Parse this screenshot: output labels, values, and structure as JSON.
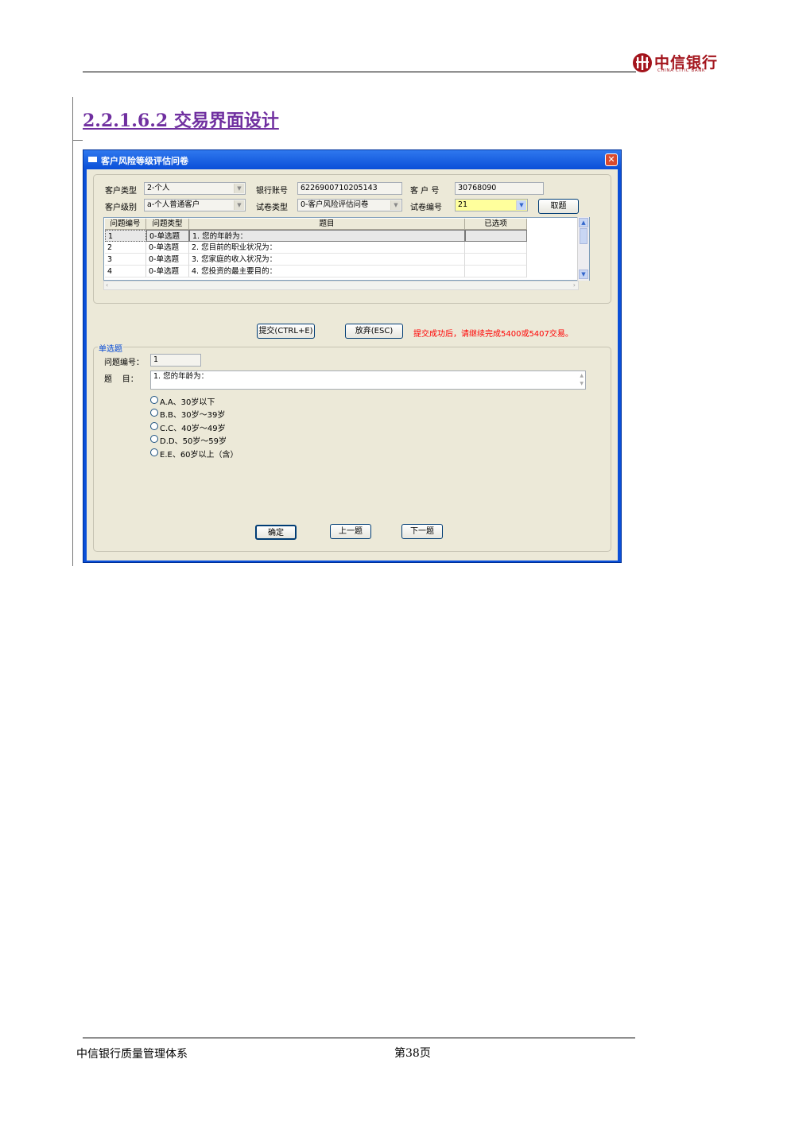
{
  "header": {
    "logo_cn": "中信银行",
    "logo_en": "CHINA CITIC BANK",
    "brand_color": "#a3141c"
  },
  "section": {
    "heading": "2.2.1.6.2 交易界面设计",
    "heading_color": "#7030a0"
  },
  "window": {
    "title": "客户风险等级评估问卷",
    "close_glyph": "✕",
    "fields": {
      "customer_type_label": "客户类型",
      "customer_type_value": "2-个人",
      "bank_account_label": "银行账号",
      "bank_account_value": "6226900710205143",
      "customer_no_label": "客 户 号",
      "customer_no_value": "30768090",
      "customer_level_label": "客户级别",
      "customer_level_value": "a-个人普通客户",
      "paper_type_label": "试卷类型",
      "paper_type_value": "0-客户风险评估问卷",
      "paper_no_label": "试卷编号",
      "paper_no_value": "21",
      "fetch_button": "取题"
    },
    "table": {
      "columns": [
        "问题编号",
        "问题类型",
        "题目",
        "已选项"
      ],
      "rows": [
        [
          "1",
          "0-单选题",
          "1. 您的年龄为：",
          ""
        ],
        [
          "2",
          "0-单选题",
          "2. 您目前的职业状况为：",
          ""
        ],
        [
          "3",
          "0-单选题",
          "3. 您家庭的收入状况为：",
          ""
        ],
        [
          "4",
          "0-单选题",
          "4. 您投资的最主要目的：",
          ""
        ]
      ]
    },
    "actions": {
      "submit": "提交(CTRL+E)",
      "cancel": "放弃(ESC)",
      "note": "提交成功后，请继续完成5400或5407交易。",
      "note_color": "#ff0000"
    },
    "question": {
      "group_label": "单选题",
      "number_label": "问题编号：",
      "number_value": "1",
      "title_label": "题    目：",
      "title_value": "1. 您的年龄为：",
      "options": [
        "A.A、30岁以下",
        "B.B、30岁～39岁",
        "C.C、40岁～49岁",
        "D.D、50岁～59岁",
        "E.E、60岁以上（含）"
      ]
    },
    "nav": {
      "ok": "确定",
      "prev": "上一题",
      "next": "下一题"
    },
    "colors": {
      "title_bar": "#0a4fd8",
      "client": "#ece9d8",
      "highlight_input": "#ffff9c"
    }
  },
  "footer": {
    "left": "中信银行质量管理体系",
    "page": "第38页"
  }
}
